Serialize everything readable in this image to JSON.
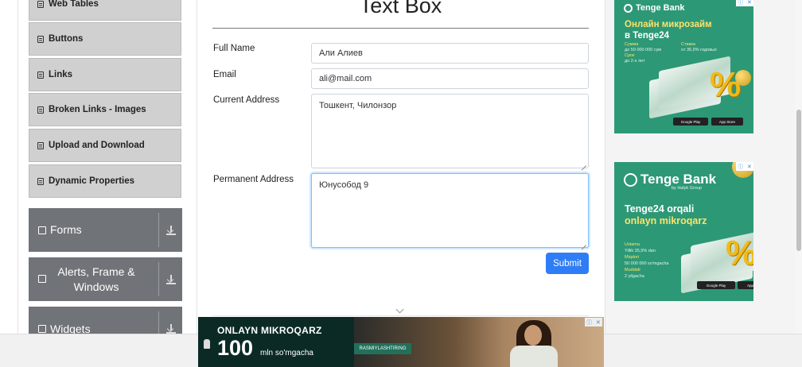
{
  "sidebar": {
    "elements_items": [
      {
        "label": "Web Tables"
      },
      {
        "label": "Buttons"
      },
      {
        "label": "Links"
      },
      {
        "label": "Broken Links - Images"
      },
      {
        "label": "Upload and Download"
      },
      {
        "label": "Dynamic Properties"
      }
    ],
    "groups": [
      {
        "label": "Forms"
      },
      {
        "label": "Alerts, Frame & Windows"
      },
      {
        "label": "Widgets"
      }
    ]
  },
  "form": {
    "title": "Text Box",
    "full_name": {
      "label": "Full Name",
      "value": "Али Алиев"
    },
    "email": {
      "label": "Email",
      "value": "ali@mail.com"
    },
    "current_address": {
      "label": "Current Address",
      "value": "Тошкент, Чилонзор"
    },
    "permanent_address": {
      "label": "Permanent Address",
      "value": "Юнусобод 9"
    },
    "submit_label": "Submit"
  },
  "ads": {
    "ad1": {
      "brand": "Tenge Bank",
      "headline_1": "Онлайн микрозайм",
      "headline_2": "в Tenge24",
      "col1": [
        "Сумма",
        "до 50 000 000 сум",
        "Срок",
        "до 2-х лет"
      ],
      "col2": [
        "Ставка",
        "от 35,9% годовых"
      ],
      "google_play": "Google Play",
      "app_store": "App Store"
    },
    "ad2": {
      "brand": "Tenge Bank",
      "brand_sub": "by Halyk Group",
      "headline_1": "Tenge24 orqali",
      "headline_2": "onlayn mikroqarz",
      "lines": [
        "Ustama",
        "Yillik 35,9% dan",
        "Miqdori",
        "50 000 000 so'mgacha",
        "Muddati",
        "2 yilgacha"
      ],
      "google_play": "Google Play",
      "app_store": "App Store"
    },
    "banner": {
      "title": "ONLAYN MIKROQARZ",
      "amount": "100",
      "unit": "mln so'mgacha",
      "cta": "RASMIYLASHTIRING"
    }
  },
  "colors": {
    "accent": "#2f7df6",
    "sidebar_group": "#707378",
    "sidebar_item": "#d0d0d0",
    "ad_green": "#2d9876"
  }
}
